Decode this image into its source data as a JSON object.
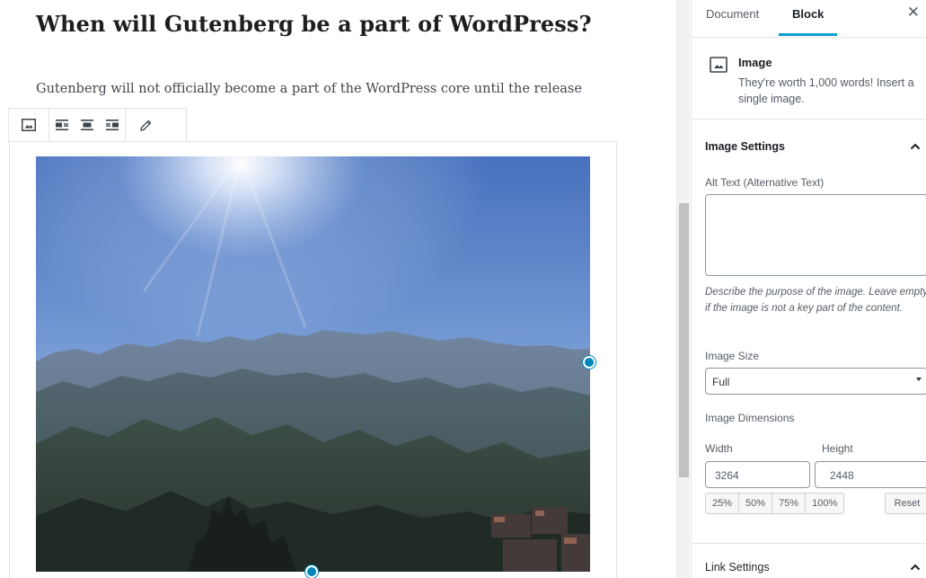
{
  "editor": {
    "title": "When will Gutenberg be a part of WordPress?",
    "paragraph": "Gutenberg will not officially become a part of the WordPress core until the release of WordPress 5.0.",
    "toolbar": {
      "image_icon": "image-icon",
      "align_left_icon": "align-left-icon",
      "align_center_icon": "align-center-icon",
      "align_right_icon": "align-right-icon",
      "edit_icon": "pencil-icon"
    },
    "image": {
      "description_icon": "mountain-landscape-photo"
    }
  },
  "sidebar": {
    "tabs": [
      {
        "label": "Document",
        "active": false
      },
      {
        "label": "Block",
        "active": true
      }
    ],
    "close_icon": "close-icon",
    "block_card": {
      "icon": "image-icon",
      "title": "Image",
      "description": "They're worth 1,000 words! Insert a single image."
    },
    "image_settings": {
      "title": "Image Settings",
      "alt_label": "Alt Text (Alternative Text)",
      "alt_value": "",
      "alt_help": "Describe the purpose of the image. Leave empty if the image is not a key part of the content.",
      "size_label": "Image Size",
      "size_value": "Full",
      "dimensions_label": "Image Dimensions",
      "width_label": "Width",
      "width_value": "3264",
      "height_label": "Height",
      "height_value": "2448",
      "percent_buttons": [
        "25%",
        "50%",
        "75%",
        "100%"
      ],
      "reset_label": "Reset"
    },
    "link_settings": {
      "title": "Link Settings"
    }
  },
  "colors": {
    "accent": "#00a0d2",
    "handle": "#0085ba",
    "border": "#e2e4e7"
  }
}
